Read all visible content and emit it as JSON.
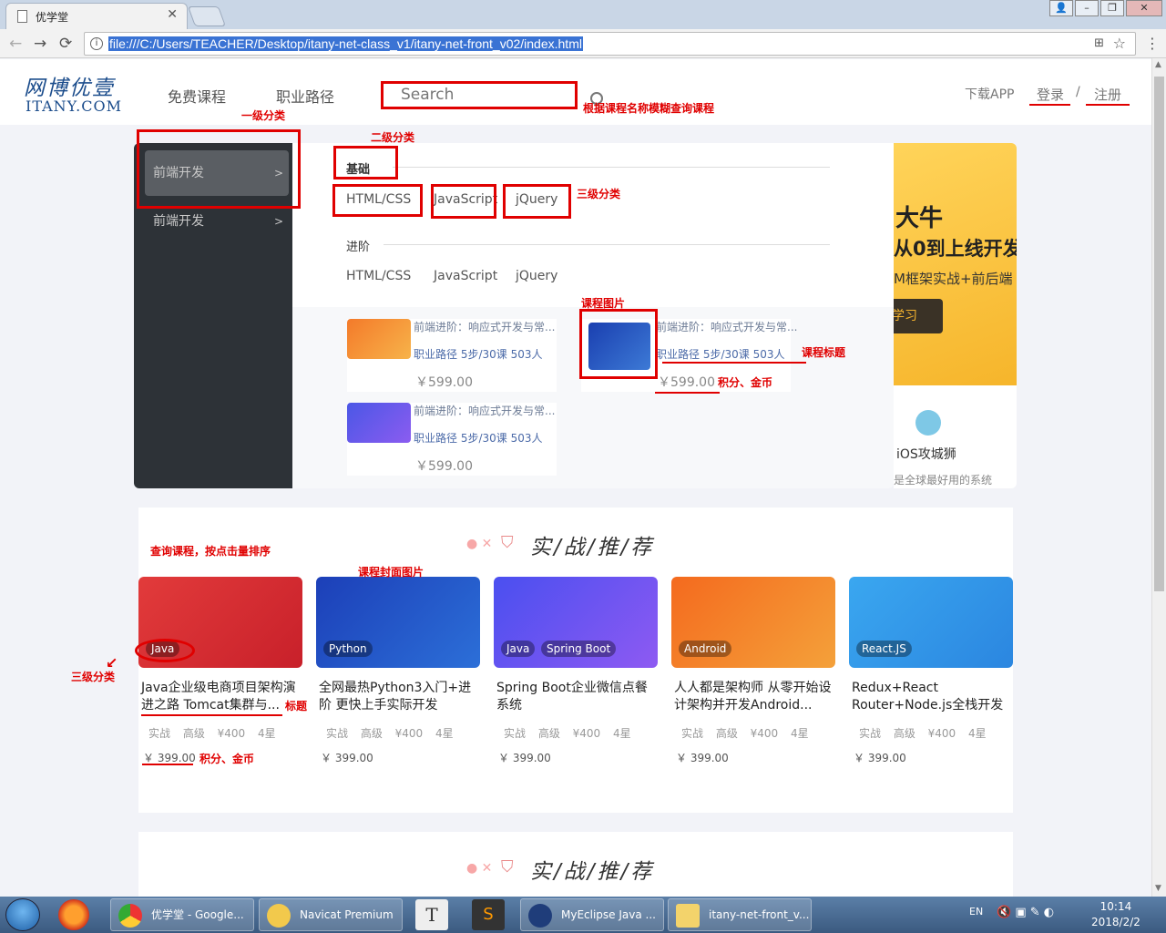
{
  "browser": {
    "tab_title": "优学堂",
    "url": "file:///C:/Users/TEACHER/Desktop/itany-net-class_v1/itany-net-front_v02/index.html"
  },
  "site": {
    "logo_cn": "网博优壹",
    "logo_en": "ITANY.COM",
    "nav": [
      "免费课程",
      "职业路径"
    ],
    "search_placeholder": "Search",
    "download": "下载APP",
    "login": "登录",
    "sep": "/",
    "register": "注册"
  },
  "menu": {
    "level1": [
      {
        "label": "前端开发",
        "arrow": ">"
      },
      {
        "label": "前端开发",
        "arrow": ">"
      }
    ],
    "groups": [
      {
        "title": "基础",
        "items": [
          "HTML/CSS",
          "JavaScript",
          "jQuery"
        ]
      },
      {
        "title": "进阶",
        "items": [
          "HTML/CSS",
          "JavaScript",
          "jQuery"
        ]
      }
    ],
    "courses": [
      {
        "title": "前端进阶：响应式开发与常...",
        "meta": "职业路径   5步/30课   503人",
        "price": "￥599.00"
      },
      {
        "title": "前端进阶：响应式开发与常...",
        "meta": "职业路径   5步/30课   503人",
        "price": "￥599.00"
      },
      {
        "title": "前端进阶：响应式开发与常...",
        "meta": "职业路径   5步/30课   503人",
        "price": "￥599.00"
      }
    ],
    "banner": {
      "l1": "大牛",
      "l2": "从0到上线开发",
      "l3": "M框架实战+前后端",
      "btn": "学习"
    },
    "ios": {
      "name": "iOS攻城狮",
      "desc": "是全球最好用的系统"
    }
  },
  "recommend": {
    "title": "实/战/推/荐",
    "cards": [
      {
        "tag": "Java",
        "tag2": "",
        "title": "Java企业级电商项目架构演进之路 Tomcat集群与...",
        "meta": "实战 高级 ¥400 4星",
        "price": "￥ 399.00"
      },
      {
        "tag": "Python",
        "tag2": "",
        "title": "全网最热Python3入门+进阶 更快上手实际开发",
        "meta": "实战 高级 ¥400 4星",
        "price": "￥ 399.00"
      },
      {
        "tag": "Java",
        "tag2": "Spring Boot",
        "title": "Spring Boot企业微信点餐系统",
        "meta": "实战 高级 ¥400 4星",
        "price": "￥ 399.00"
      },
      {
        "tag": "Android",
        "tag2": "",
        "title": "人人都是架构师 从零开始设计架构并开发Android...",
        "meta": "实战 高级 ¥400 4星",
        "price": "￥ 399.00"
      },
      {
        "tag": "React.JS",
        "tag2": "",
        "title": "Redux+React Router+Node.js全栈开发",
        "meta": "实战 高级 ¥400 4星",
        "price": "￥ 399.00"
      }
    ],
    "title2": "实/战/推/荐"
  },
  "annotations": {
    "level1": "一级分类",
    "level2": "二级分类",
    "level3": "三级分类",
    "search_note": "根据课程名称模糊查询课程",
    "course_img": "课程图片",
    "course_title": "课程标题",
    "points_gold": "积分、金币",
    "query_sort": "查询课程，按点击量排序",
    "cover_img": "课程封面图片",
    "title": "标题",
    "level3_b": "三级分类",
    "points_gold_b": "积分、金币"
  },
  "taskbar": {
    "buttons": [
      "优学堂 - Google...",
      "Navicat Premium",
      "MyEclipse Java ...",
      "itany-net-front_v..."
    ],
    "lang": "EN",
    "time": "10:14",
    "date": "2018/2/2"
  },
  "colors": {
    "annotation_red": "#e00000",
    "menu_dark": "#2d3237",
    "link_blue": "#4b6aa8"
  }
}
